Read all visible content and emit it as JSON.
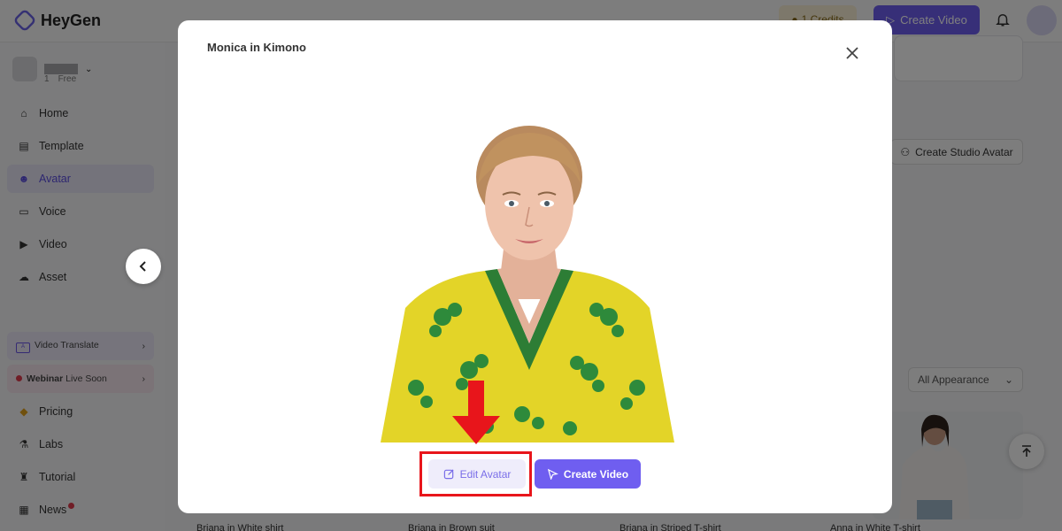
{
  "app": {
    "brand": "HeyGen",
    "credits_label": "1 Credits",
    "create_video_label": "Create Video"
  },
  "workspace": {
    "members": "1",
    "plan": "Free"
  },
  "sidebar": {
    "items": [
      {
        "label": "Home",
        "icon": "home-icon"
      },
      {
        "label": "Template",
        "icon": "template-icon"
      },
      {
        "label": "Avatar",
        "icon": "avatar-icon"
      },
      {
        "label": "Voice",
        "icon": "voice-icon"
      },
      {
        "label": "Video",
        "icon": "video-icon"
      },
      {
        "label": "Asset",
        "icon": "asset-icon"
      }
    ],
    "promo_video_translate": "Video Translate",
    "promo_webinar_bold": "Webinar",
    "promo_webinar_rest": "Live Soon",
    "bottom_items": [
      {
        "label": "Pricing",
        "icon": "diamond-icon"
      },
      {
        "label": "Labs",
        "icon": "flask-icon"
      },
      {
        "label": "Tutorial",
        "icon": "graduation-cap-icon"
      },
      {
        "label": "News",
        "icon": "news-icon"
      }
    ]
  },
  "main": {
    "create_studio_avatar": "Create Studio Avatar",
    "appearance_filter": "All Appearance",
    "card_labels": [
      "Briana in White shirt",
      "Briana in Brown suit",
      "Briana in Striped T-shirt",
      "Anna in White T-shirt"
    ]
  },
  "modal": {
    "title": "Monica in Kimono",
    "edit_avatar": "Edit Avatar",
    "create_video": "Create Video"
  },
  "colors": {
    "accent": "#6f5ef0",
    "annotation": "#e8151b",
    "kimono": "#e3d428",
    "leaf": "#2e8a3b"
  }
}
